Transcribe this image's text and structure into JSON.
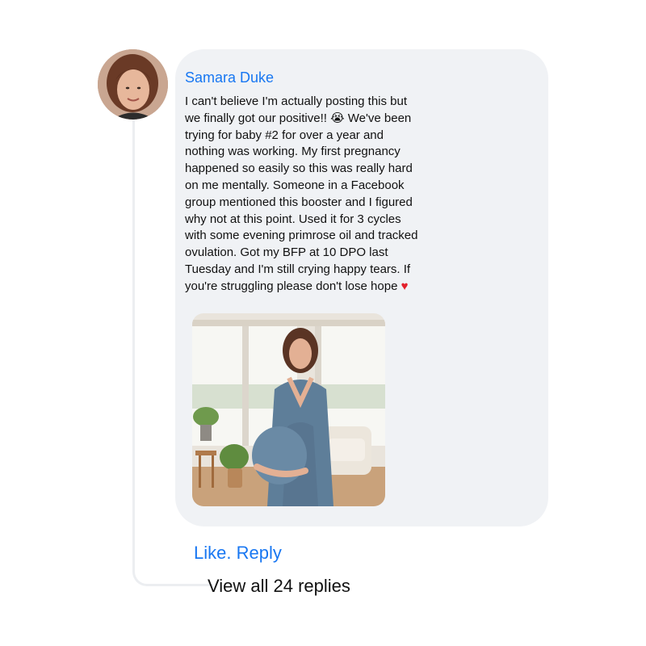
{
  "comment": {
    "author": "Samara Duke",
    "lines": [
      "I can't believe I'm actually posting this but",
      "we finally got our positive!! 😭 We've been",
      "trying for baby #2 for over a year and",
      "nothing was working. My first pregnancy",
      "happened so easily so this was really hard",
      "on me mentally. Someone in a Facebook",
      "group mentioned this booster and I figured",
      "why not at this point. Used it for 3 cycles",
      "with some evening primrose oil and tracked",
      "ovulation. Got my BFP at 10 DPO last",
      "Tuesday and I'm still crying happy tears. If",
      "you're struggling please don't lose hope"
    ],
    "end_emoji": "♥"
  },
  "actions": {
    "like_label": "Like.",
    "reply_label": "Reply",
    "view_replies_label": "View all 24 replies"
  },
  "icons": {
    "avatar": "profile-photo",
    "attachment": "pregnancy-photo",
    "crying-emoji": "loudly-crying-face",
    "heart-emoji": "red-heart"
  },
  "colors": {
    "link_blue": "#1877f2",
    "bubble_bg": "#f0f2f5",
    "text": "#111111",
    "thread_line": "#eceef1",
    "heart": "#e3202b"
  }
}
